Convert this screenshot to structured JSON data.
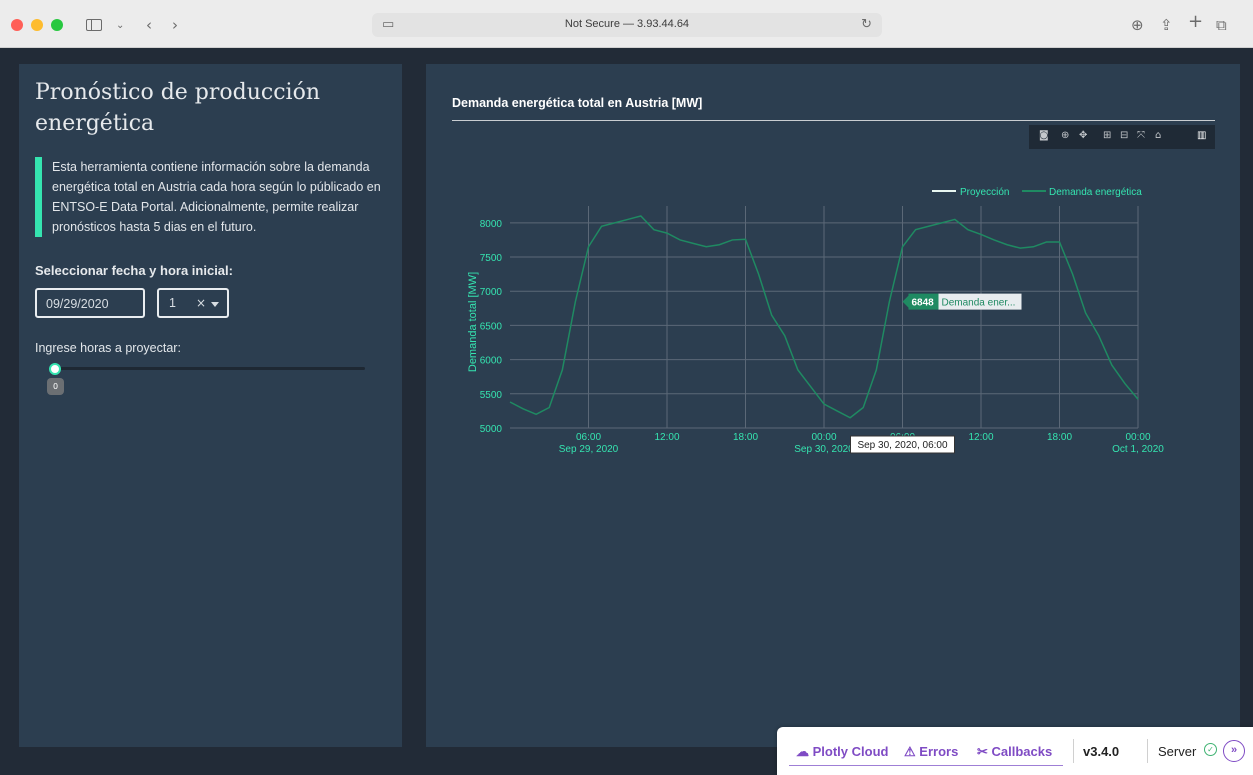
{
  "browser": {
    "address": "Not Secure — 3.93.44.64"
  },
  "sidebar": {
    "title": "Pronóstico de producción energética",
    "description": "Esta herramienta contiene información sobre la demanda energética total en Austria cada hora según lo públicado en ENTSO-E Data Portal. Adicionalmente, permite realizar pronósticos hasta 5 dias en el futuro.",
    "date_label": "Seleccionar fecha y hora inicial:",
    "date_value": "09/29/2020",
    "hour_value": "1",
    "hour_clear": "×",
    "hours_label": "Ingrese horas a proyectar:",
    "slider_value": "0"
  },
  "chart": {
    "title": "Demanda energética total en Austria [MW]",
    "hover_value": "6848",
    "hover_series": "Demanda ener...",
    "hover_x": "Sep 30, 2020, 06:00"
  },
  "chart_data": {
    "type": "line",
    "ylabel": "Demanda total [MW]",
    "ylim": [
      5000,
      8100
    ],
    "yticks": [
      5000,
      5500,
      6000,
      6500,
      7000,
      7500,
      8000
    ],
    "xticks": [
      {
        "h": 6,
        "label": "06:00",
        "sub": "Sep 29, 2020"
      },
      {
        "h": 12,
        "label": "12:00",
        "sub": ""
      },
      {
        "h": 18,
        "label": "18:00",
        "sub": ""
      },
      {
        "h": 24,
        "label": "00:00",
        "sub": "Sep 30, 2020"
      },
      {
        "h": 30,
        "label": "06:00",
        "sub": ""
      },
      {
        "h": 36,
        "label": "12:00",
        "sub": ""
      },
      {
        "h": 42,
        "label": "18:00",
        "sub": ""
      },
      {
        "h": 48,
        "label": "00:00",
        "sub": "Oct 1, 2020"
      }
    ],
    "grid": true,
    "legend": "top-right",
    "series": [
      {
        "name": "Proyección",
        "color": "#e8f6f1",
        "values": []
      },
      {
        "name": "Demanda energética",
        "color": "#1f8a62",
        "x_start_hour": 1,
        "values": [
          5380,
          5280,
          5200,
          5300,
          5850,
          6850,
          7650,
          7950,
          8000,
          8050,
          8100,
          7900,
          7850,
          7750,
          7700,
          7650,
          7680,
          7750,
          7760,
          7250,
          6650,
          6350,
          5850,
          5600,
          5350,
          5250,
          5150,
          5300,
          5850,
          6850,
          7650,
          7900,
          7950,
          8000,
          8050,
          7900,
          7830,
          7750,
          7680,
          7630,
          7650,
          7720,
          7720,
          7250,
          6680,
          6350,
          5920,
          5650,
          5420
        ]
      }
    ]
  },
  "debug_bar": {
    "cloud": "Plotly Cloud",
    "errors": "Errors",
    "callbacks": "Callbacks",
    "version": "v3.4.0",
    "server": "Server"
  }
}
